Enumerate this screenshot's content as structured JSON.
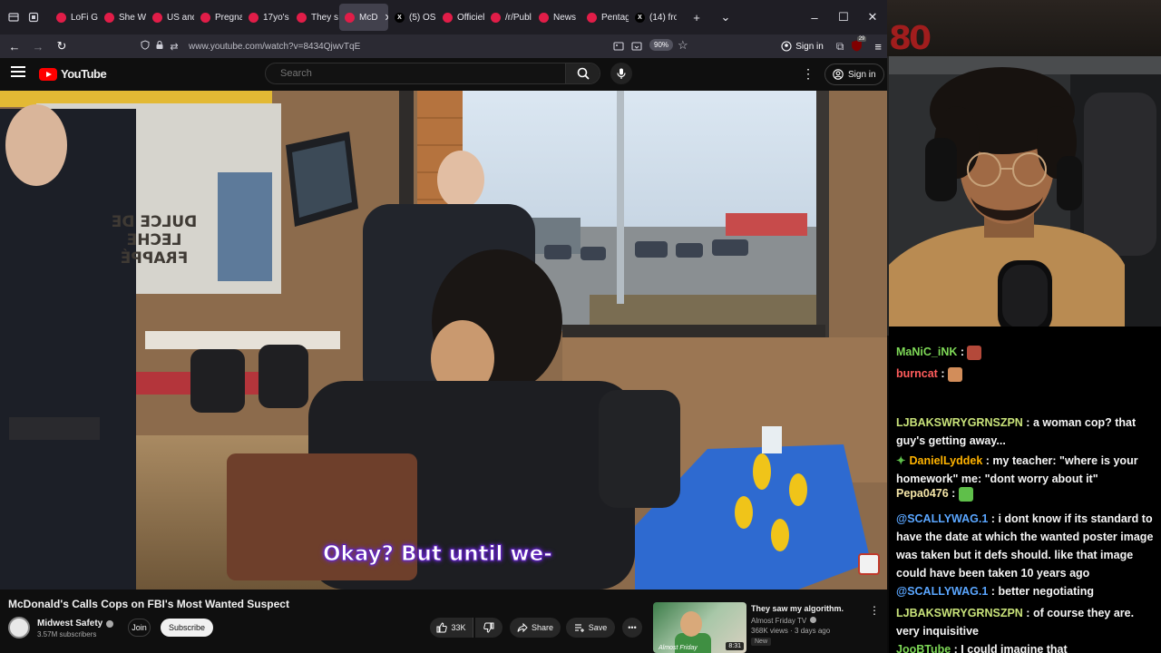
{
  "browser": {
    "tabs": [
      {
        "label": "LoFi G",
        "color": "#e11d48",
        "active": false
      },
      {
        "label": "She W",
        "color": "#e11d48",
        "active": false
      },
      {
        "label": "US and",
        "color": "#e11d48",
        "active": false
      },
      {
        "label": "Pregna",
        "color": "#e11d48",
        "active": false
      },
      {
        "label": "17yo's",
        "color": "#e11d48",
        "active": false
      },
      {
        "label": "They s",
        "color": "#e11d48",
        "active": false
      },
      {
        "label": "McD",
        "color": "#e11d48",
        "active": true
      },
      {
        "label": "(5) OSI",
        "color": "#000000",
        "active": false
      },
      {
        "label": "Officiel",
        "color": "#e11d48",
        "active": false
      },
      {
        "label": "/r/Publ",
        "color": "#e11d48",
        "active": false
      },
      {
        "label": "News",
        "color": "#e11d48",
        "active": false
      },
      {
        "label": "Pentag",
        "color": "#e11d48",
        "active": false
      },
      {
        "label": "(14) fro",
        "color": "#000000",
        "active": false
      }
    ],
    "url": "www.youtube.com/watch?v=8434QjwvTqE",
    "zoom": "90%",
    "signin_label": "Sign in",
    "extension_badge": "29"
  },
  "youtube": {
    "logo_text": "YouTube",
    "search_placeholder": "Search",
    "signin_label": "Sign in",
    "subtitle": "Okay? But until we-",
    "video_title": "McDonald's Calls Cops on FBI's Most Wanted Suspect",
    "channel_name": "Midwest Safety",
    "subscribers": "3.57M subscribers",
    "join_label": "Join",
    "subscribe_label": "Subscribe",
    "like_count": "33K",
    "share_label": "Share",
    "save_label": "Save",
    "window_sign_text": [
      "DULCE DE",
      "LECHE",
      "FRAPPÉ"
    ],
    "recommended": {
      "title": "They saw my algorithm.",
      "channel": "Almost Friday TV",
      "meta": "368K views · 3 days ago",
      "badge": "New",
      "duration": "8:31",
      "overlay_text": "Almost Friday"
    }
  },
  "stream": {
    "logo_text": "80"
  },
  "chat": {
    "messages": [
      {
        "user": "MaNiC_iNK",
        "user_color": "#7ed957",
        "text": "",
        "emote": "#b4493a"
      },
      {
        "user": "burncat",
        "user_color": "#ff5c5c",
        "text": "",
        "emote": "#d28d5a"
      },
      {
        "user": "LJBAKSWRYGRNSZPN",
        "user_color": "#c9e37a",
        "text": "a woman cop? that guy's getting away..."
      },
      {
        "user": "DanielLyddek",
        "user_color": "#ffb300",
        "text": "my teacher: \"where is your homework\" me: \"dont worry about it\"",
        "prefix": "✦"
      },
      {
        "user": "Pepa0476",
        "user_color": "#f5e6a8",
        "text": "",
        "emote": "#5fbf4a"
      },
      {
        "user": "@SCALLYWAG.1",
        "user_color": "#5aa6ff",
        "text": "i dont know if its standard to have the date at which the wanted poster image was taken but it defs should. like that image could have been taken 10 years ago"
      },
      {
        "user": "@SCALLYWAG.1",
        "user_color": "#5aa6ff",
        "text": "better negotiating"
      },
      {
        "user": "LJBAKSWRYGRNSZPN",
        "user_color": "#c9e37a",
        "text": "of course they are. very inquisitive"
      },
      {
        "user": "JooBTube",
        "user_color": "#7ed957",
        "text": "I could imagine that"
      }
    ]
  }
}
